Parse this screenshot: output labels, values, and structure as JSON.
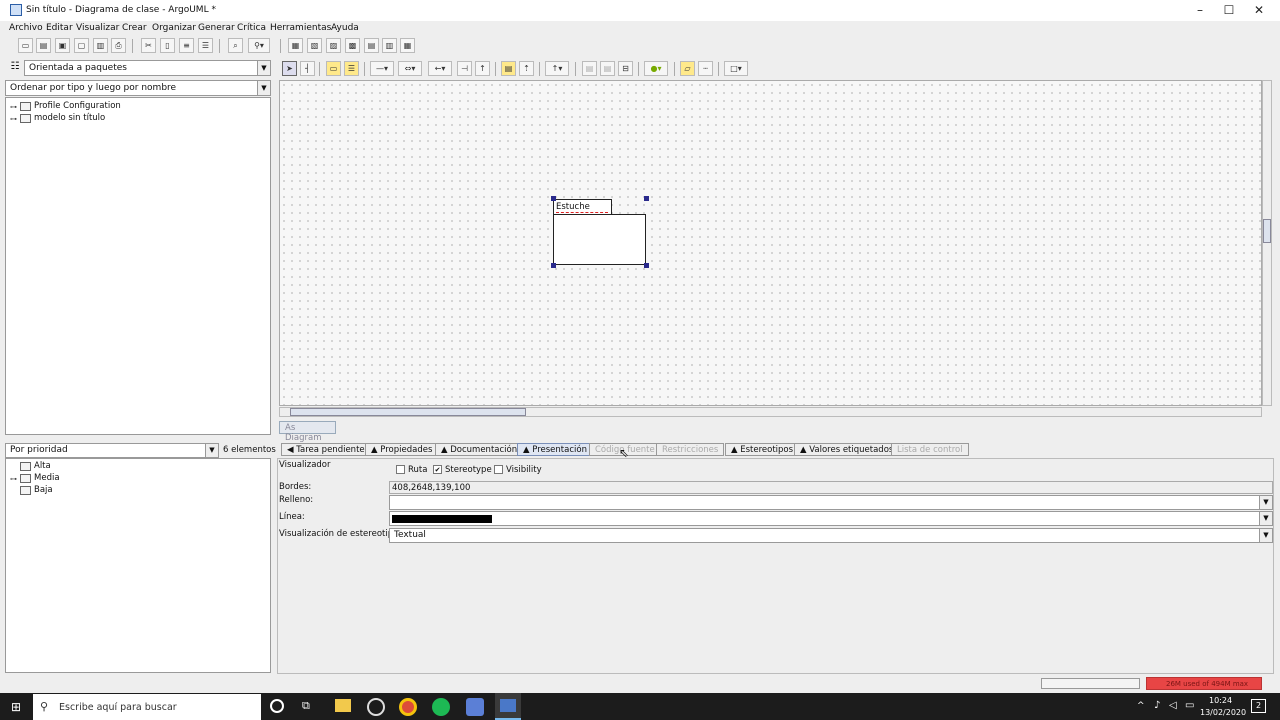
{
  "window": {
    "title": "Sin título - Diagrama de clase - ArgoUML *"
  },
  "menu": [
    "Archivo",
    "Editar",
    "Visualizar",
    "Crear",
    "Organizar",
    "Generar",
    "Crítica",
    "Herramientas",
    "Ayuda"
  ],
  "nav": {
    "perspective": "Orientada a paquetes",
    "order": "Ordenar por tipo y luego por nombre",
    "tree": [
      "Profile Configuration",
      "modelo sin título"
    ]
  },
  "diagram": {
    "package_name": "Estuche",
    "tab_label": "As Diagram"
  },
  "todo": {
    "priority": "Por prioridad",
    "count": "6 elementos",
    "items": [
      "Alta",
      "Media",
      "Baja"
    ]
  },
  "details_tabs": [
    {
      "label": "◀ Tarea pendiente",
      "state": "normal"
    },
    {
      "label": "▲ Propiedades",
      "state": "normal"
    },
    {
      "label": "▲ Documentación",
      "state": "normal"
    },
    {
      "label": "▲ Presentación",
      "state": "active"
    },
    {
      "label": "Código fuente",
      "state": "disabled"
    },
    {
      "label": "Restricciones",
      "state": "disabled"
    },
    {
      "label": "▲ Estereotipos",
      "state": "normal"
    },
    {
      "label": "▲ Valores etiquetados",
      "state": "normal"
    },
    {
      "label": "Lista de control",
      "state": "disabled"
    }
  ],
  "presentation": {
    "visualizador": "Visualizador",
    "ruta": "Ruta",
    "stereotype": "Stereotype",
    "visibility": "Visibility",
    "ruta_checked": false,
    "stereotype_checked": true,
    "visibility_checked": false,
    "bordes_label": "Bordes:",
    "bordes_value": "408,2648,139,100",
    "relleno_label": "Relleno:",
    "linea_label": "Línea:",
    "estereotipo_label": "Visualización de estereotipo:",
    "estereotipo_value": "Textual",
    "fill_color": "#ffffff",
    "line_color": "#000000"
  },
  "status": {
    "memory": "26M used of 494M max"
  },
  "taskbar": {
    "search_placeholder": "Escribe aquí para buscar",
    "time": "10:24",
    "date": "13/02/2020",
    "notifications": "2"
  },
  "colors": {
    "memory_bar": "#e84545",
    "selection": "#2a2a8c",
    "taskbar": "#1c1c1c"
  }
}
